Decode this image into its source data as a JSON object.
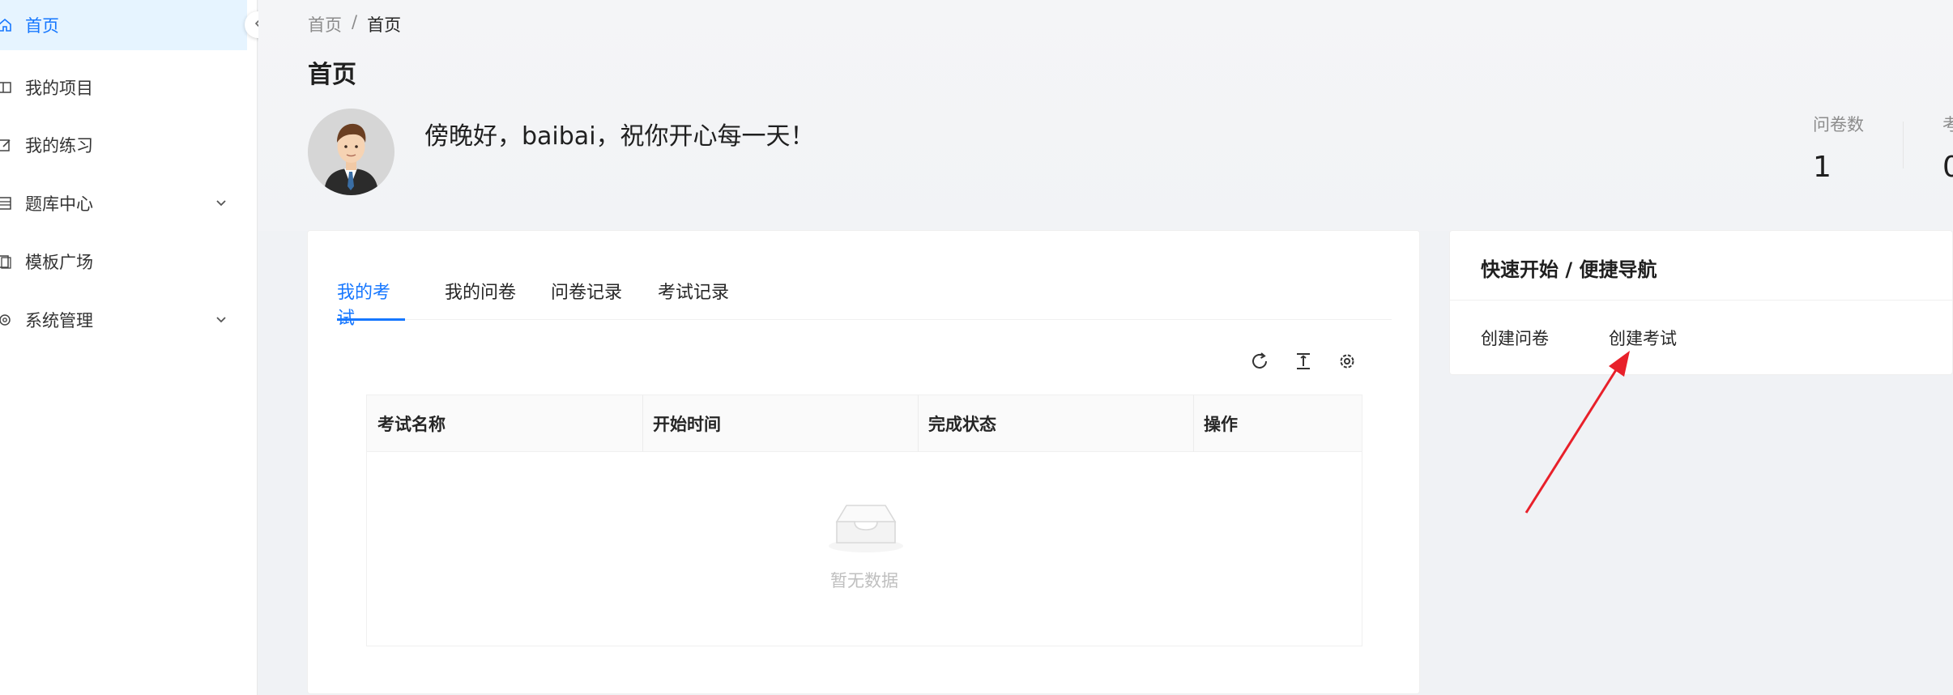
{
  "sidebar": {
    "items": [
      {
        "label": "首页",
        "icon": "home-icon",
        "active": true
      },
      {
        "label": "我的项目",
        "icon": "project-icon"
      },
      {
        "label": "我的练习",
        "icon": "edit-icon"
      },
      {
        "label": "题库中心",
        "icon": "list-icon",
        "expandable": true
      },
      {
        "label": "模板广场",
        "icon": "template-icon"
      },
      {
        "label": "系统管理",
        "icon": "gear-icon",
        "expandable": true
      }
    ]
  },
  "breadcrumb": {
    "root": "首页",
    "separator": "/",
    "current": "首页"
  },
  "page": {
    "title": "首页"
  },
  "greeting": "傍晚好，baibai，祝你开心每一天！",
  "stats": [
    {
      "label": "问卷数",
      "value": "1"
    },
    {
      "label": "考",
      "value": "0"
    }
  ],
  "tabs": [
    "我的考试",
    "我的问卷",
    "问卷记录",
    "考试记录"
  ],
  "table": {
    "columns": [
      "考试名称",
      "开始时间",
      "完成状态",
      "操作"
    ],
    "empty_text": "暂无数据"
  },
  "quick_nav": {
    "title": "快速开始 / 便捷导航",
    "links": [
      "创建问卷",
      "创建考试"
    ]
  },
  "colors": {
    "accent": "#1677ff",
    "arrow": "#e8202a"
  }
}
